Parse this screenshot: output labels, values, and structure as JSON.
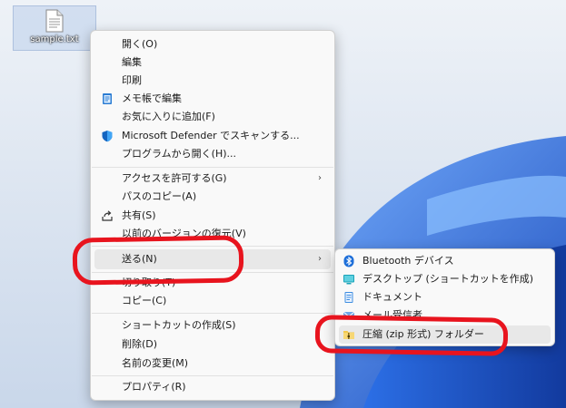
{
  "desktop": {
    "file_icon": "text-file-icon",
    "file_label": "sample.txt"
  },
  "context_menu": {
    "items": [
      {
        "label": "開く(O)",
        "icon": ""
      },
      {
        "label": "編集",
        "icon": ""
      },
      {
        "label": "印刷",
        "icon": ""
      },
      {
        "label": "メモ帳で編集",
        "icon": "notepad-icon"
      },
      {
        "label": "お気に入りに追加(F)",
        "icon": ""
      },
      {
        "label": "Microsoft Defender でスキャンする...",
        "icon": "defender-shield-icon"
      },
      {
        "label": "プログラムから開く(H)...",
        "icon": ""
      },
      {
        "label": "アクセスを許可する(G)",
        "icon": "",
        "submenu": true
      },
      {
        "label": "パスのコピー(A)",
        "icon": ""
      },
      {
        "label": "共有(S)",
        "icon": "share-icon"
      },
      {
        "label": "以前のバージョンの復元(V)",
        "icon": ""
      },
      {
        "label": "送る(N)",
        "icon": "",
        "submenu": true
      },
      {
        "label": "切り取り(T)",
        "icon": ""
      },
      {
        "label": "コピー(C)",
        "icon": ""
      },
      {
        "label": "ショートカットの作成(S)",
        "icon": ""
      },
      {
        "label": "削除(D)",
        "icon": ""
      },
      {
        "label": "名前の変更(M)",
        "icon": ""
      },
      {
        "label": "プロパティ(R)",
        "icon": ""
      }
    ]
  },
  "send_to_menu": {
    "items": [
      {
        "label": "Bluetooth デバイス",
        "icon": "bluetooth-icon"
      },
      {
        "label": "デスクトップ (ショートカットを作成)",
        "icon": "desktop-icon"
      },
      {
        "label": "ドキュメント",
        "icon": "documents-icon"
      },
      {
        "label": "メール受信者",
        "icon": "mail-icon"
      },
      {
        "label": "圧縮 (zip 形式) フォルダー",
        "icon": "zip-folder-icon"
      }
    ]
  },
  "colors": {
    "annotation_red": "#e8141e",
    "highlight": "#e8e8e8",
    "wallpaper_blue": "#1f5fd6"
  }
}
